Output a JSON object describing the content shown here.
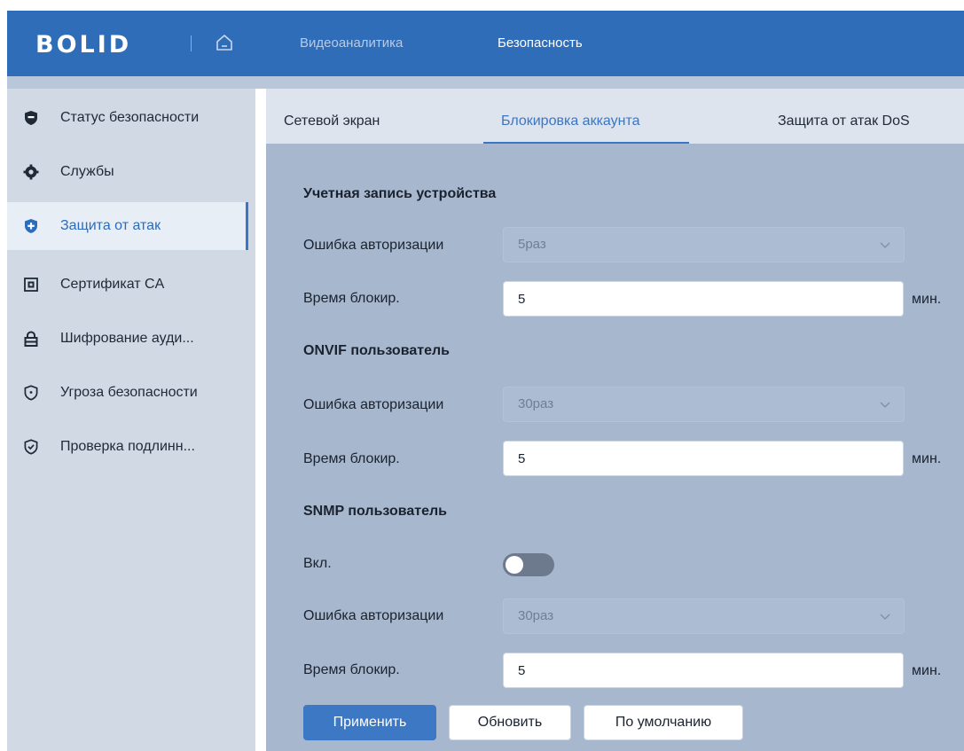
{
  "header": {
    "logo_text": "BOLID",
    "nav": [
      {
        "label": "Видеоаналитика",
        "active": false
      },
      {
        "label": "Безопасность",
        "active": true
      }
    ],
    "icons": {
      "home": "home-icon"
    }
  },
  "sidebar": {
    "items": [
      {
        "label": "Статус безопасности",
        "icon": "shield-filled-icon",
        "active": false
      },
      {
        "label": "Службы",
        "icon": "gear-icon",
        "active": false
      },
      {
        "label": "Защита от атак",
        "icon": "shield-plus-icon",
        "active": true
      },
      {
        "label": "Сертификат CA",
        "icon": "certificate-icon",
        "active": false
      },
      {
        "label": "Шифрование ауди...",
        "icon": "lock-icon",
        "active": false
      },
      {
        "label": "Угроза безопасности",
        "icon": "shield-alert-icon",
        "active": false
      },
      {
        "label": "Проверка подлинн...",
        "icon": "shield-check-icon",
        "active": false
      }
    ]
  },
  "tabs": [
    {
      "label": "Сетевой экран",
      "active": false
    },
    {
      "label": "Блокировка аккаунта",
      "active": true
    },
    {
      "label": "Защита от атак DoS",
      "active": false
    }
  ],
  "device_account": {
    "title": "Учетная запись устройства",
    "auth_error_label": "Ошибка авторизации",
    "auth_error_value": "5раз",
    "lock_time_label": "Время блокир.",
    "lock_time_value": "5",
    "unit": "мин."
  },
  "onvif_user": {
    "title": "ONVIF пользователь",
    "auth_error_label": "Ошибка авторизации",
    "auth_error_value": "30раз",
    "lock_time_label": "Время блокир.",
    "lock_time_value": "5",
    "unit": "мин."
  },
  "snmp_user": {
    "title": "SNMP пользователь",
    "enable_label": "Вкл.",
    "enabled": false,
    "auth_error_label": "Ошибка авторизации",
    "auth_error_value": "30раз",
    "lock_time_label": "Время блокир.",
    "lock_time_value": "5",
    "unit": "мин."
  },
  "buttons": {
    "apply": "Применить",
    "refresh": "Обновить",
    "default": "По умолчанию"
  },
  "colors": {
    "header_bg": "#2f6db8",
    "accent": "#3a76c4",
    "sidebar_bg": "#d1d9e4",
    "content_bg": "#a7b7cd",
    "primary_button": "#3d78c5"
  }
}
